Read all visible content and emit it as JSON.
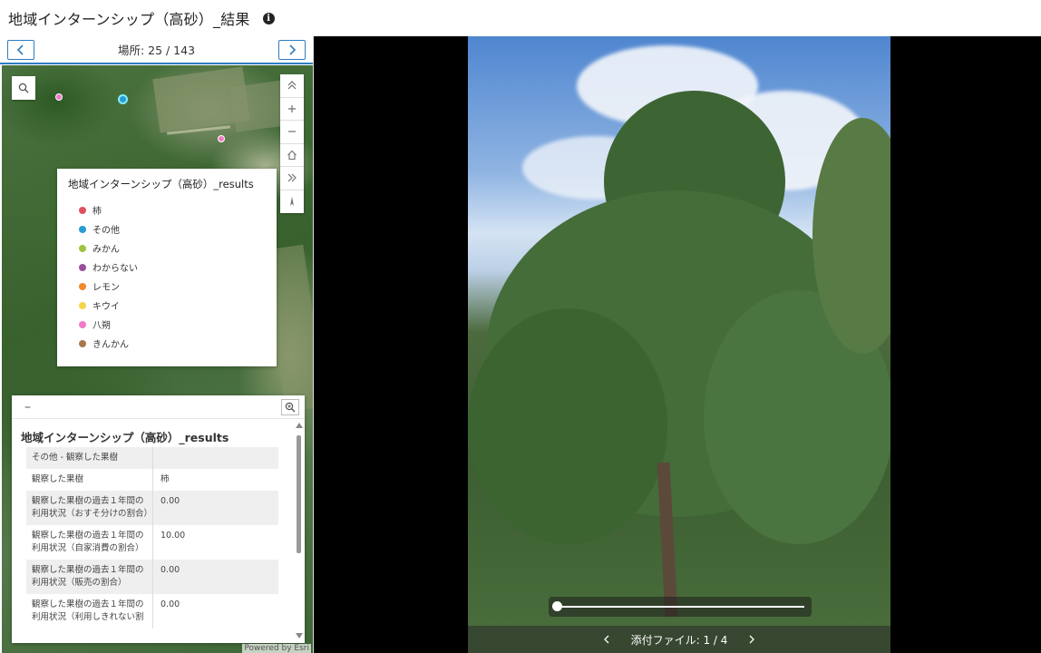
{
  "header": {
    "title": "地域インターンシップ（高砂）_結果"
  },
  "nav": {
    "counter": "場所: 25 / 143"
  },
  "legend": {
    "title": "地域インターンシップ（高砂）_results",
    "items": [
      {
        "label": "柿",
        "color": "#e05060"
      },
      {
        "label": "その他",
        "color": "#2a9bd5"
      },
      {
        "label": "みかん",
        "color": "#9cc440"
      },
      {
        "label": "わからない",
        "color": "#9b4ea0"
      },
      {
        "label": "レモン",
        "color": "#f08a2c"
      },
      {
        "label": "キウイ",
        "color": "#f2d64a"
      },
      {
        "label": "八朔",
        "color": "#f07ac8"
      },
      {
        "label": "きんかん",
        "color": "#a8784a"
      }
    ]
  },
  "popup": {
    "minimize": "–",
    "title": "地域インターンシップ（高砂）_results",
    "rows": [
      {
        "k": "その他 - 観察した果樹",
        "v": ""
      },
      {
        "k": "観察した果樹",
        "v": "柿"
      },
      {
        "k": "観察した果樹の過去１年間の利用状況（おすそ分けの割合）",
        "v": "0.00"
      },
      {
        "k": "観察した果樹の過去１年間の利用状況（自家消費の割合）",
        "v": "10.00"
      },
      {
        "k": "観察した果樹の過去１年間の利用状況（販売の割合）",
        "v": "0.00"
      },
      {
        "k": "観察した果樹の過去１年間の利用状況（利用しきれない割",
        "v": "0.00"
      }
    ]
  },
  "map": {
    "attribution": "Powered by Esri"
  },
  "viewer": {
    "attachment_label": "添付ファイル: 1 / 4"
  }
}
